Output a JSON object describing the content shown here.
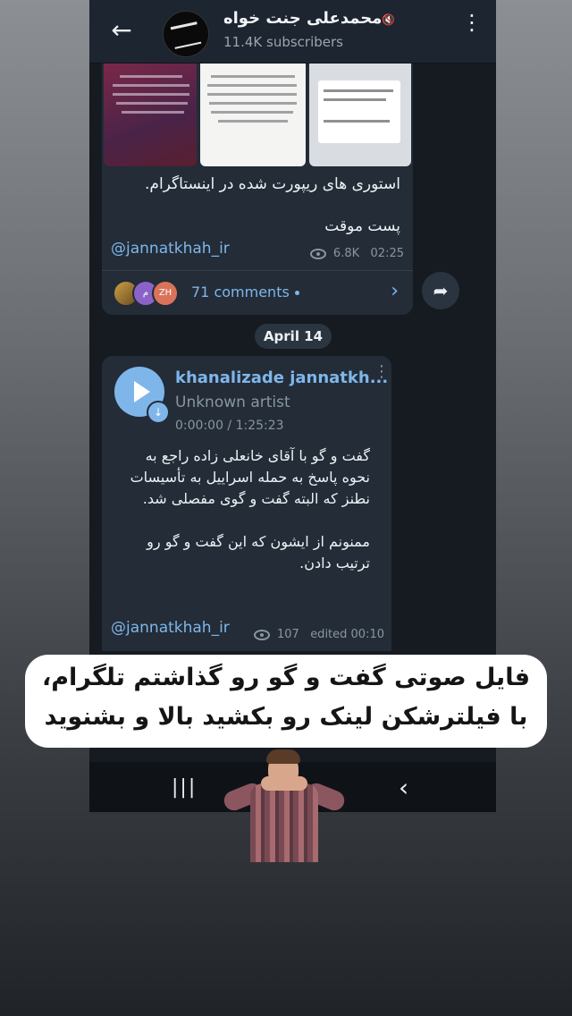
{
  "header": {
    "back_icon": "arrow-left-icon",
    "channel_title": "محمدعلی جنت خواه",
    "mute_icon": "muted-speaker-icon",
    "subscribers": "11.4K subscribers",
    "menu_icon": "more-vertical-icon"
  },
  "post1": {
    "text_line1": "استوری های ریپورت شده در اینستاگرام.",
    "text_line2": "پست موقت",
    "handle": "@jannatkhah_ir",
    "views": "6.8K",
    "time": "02:25",
    "comments_label": "71 comments",
    "commenter3_initials": "ZH",
    "commenter2_initial": "م"
  },
  "date_separator": "April 14",
  "post2": {
    "audio_title": "khanalizade jannatkh...",
    "audio_artist": "Unknown artist",
    "audio_time": "0:00:00 / 1:25:23",
    "paragraph1": "گفت و گو با آقای خانعلی زاده راجع به نحوه پاسخ به حمله اسراییل به تأسیسات نطنز که البته گفت و گوی مفصلی شد.",
    "paragraph2": "ممنونم از ایشون که این گفت و گو رو ترتیب دادن.",
    "handle": "@jannatkhah_ir",
    "views": "107",
    "edited_time": "edited 00:10"
  },
  "caption": {
    "line1": "فایل صوتی گفت و گو رو گذاشتم تلگرام،",
    "line2": "با فیلترشکن لینک رو بکشید بالا و بشنوید"
  },
  "navbar": {
    "recent_icon": "recent-apps-icon",
    "back_icon": "nav-back-icon"
  },
  "colors": {
    "accent": "#7fb6ea",
    "bubble": "#232c37",
    "header": "#1d2530"
  }
}
